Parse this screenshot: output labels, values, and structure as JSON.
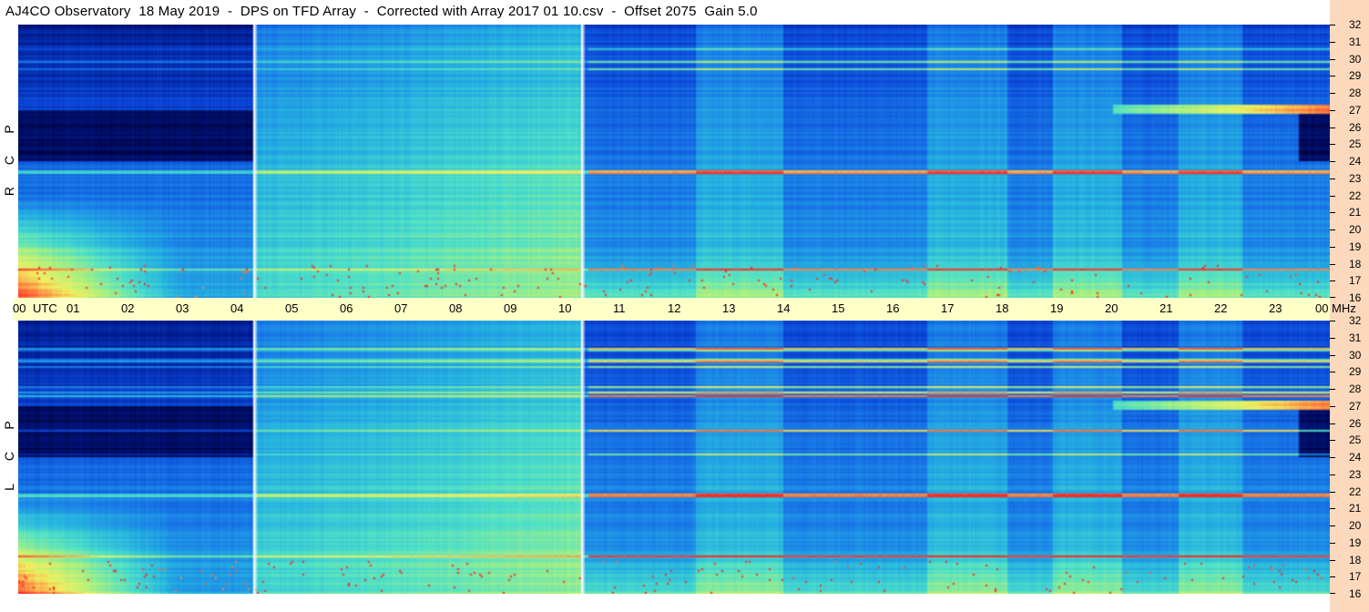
{
  "title": "AJ4CO Observatory  18 May 2019  -  DPS on TFD Array  -  Corrected with Array 2017 01 10.csv  -  Offset 2075  Gain 5.0",
  "colors": {
    "axis_background": "#ffffc8",
    "freq_background": "#fcd9bd",
    "colormap": [
      "#00003a",
      "#001a8c",
      "#0b46d8",
      "#1a7ee8",
      "#26b4e0",
      "#4ee0c8",
      "#a8f080",
      "#f0f060",
      "#ff8040",
      "#ff2020"
    ]
  },
  "chart_data": [
    {
      "type": "heatmap",
      "name": "R C P",
      "xlabel": "UTC",
      "ylabel": "MHz",
      "x_ticks": [
        "00",
        "01",
        "02",
        "03",
        "04",
        "05",
        "06",
        "07",
        "08",
        "09",
        "10",
        "11",
        "12",
        "13",
        "14",
        "15",
        "16",
        "17",
        "18",
        "19",
        "20",
        "21",
        "22",
        "23",
        "00"
      ],
      "y_ticks": [
        32,
        31,
        30,
        29,
        28,
        27,
        26,
        25,
        24,
        23,
        22,
        21,
        20,
        19,
        18,
        17,
        16
      ],
      "ylim": [
        16,
        32
      ],
      "xlim": [
        0,
        24
      ],
      "data_gaps_utc": [
        4.3,
        10.3
      ]
    },
    {
      "type": "heatmap",
      "name": "L C P",
      "xlabel": "UTC",
      "ylabel": "MHz",
      "x_ticks": [
        "00",
        "01",
        "02",
        "03",
        "04",
        "05",
        "06",
        "07",
        "08",
        "09",
        "10",
        "11",
        "12",
        "13",
        "14",
        "15",
        "16",
        "17",
        "18",
        "19",
        "20",
        "21",
        "22",
        "23",
        "00"
      ],
      "y_ticks": [
        32,
        31,
        30,
        29,
        28,
        27,
        26,
        25,
        24,
        23,
        22,
        21,
        20,
        19,
        18,
        17,
        16
      ],
      "ylim": [
        16,
        32
      ],
      "xlim": [
        0,
        24
      ],
      "data_gaps_utc": [
        4.3,
        10.3
      ]
    }
  ],
  "time_axis": {
    "labels": [
      "00",
      "UTC",
      "01",
      "02",
      "03",
      "04",
      "05",
      "06",
      "07",
      "08",
      "09",
      "10",
      "11",
      "12",
      "13",
      "14",
      "15",
      "16",
      "17",
      "18",
      "19",
      "20",
      "21",
      "22",
      "23",
      "00",
      "MHz"
    ]
  },
  "side_labels": {
    "rcp": [
      "R",
      "C",
      "P"
    ],
    "lcp": [
      "L",
      "C",
      "P"
    ]
  }
}
